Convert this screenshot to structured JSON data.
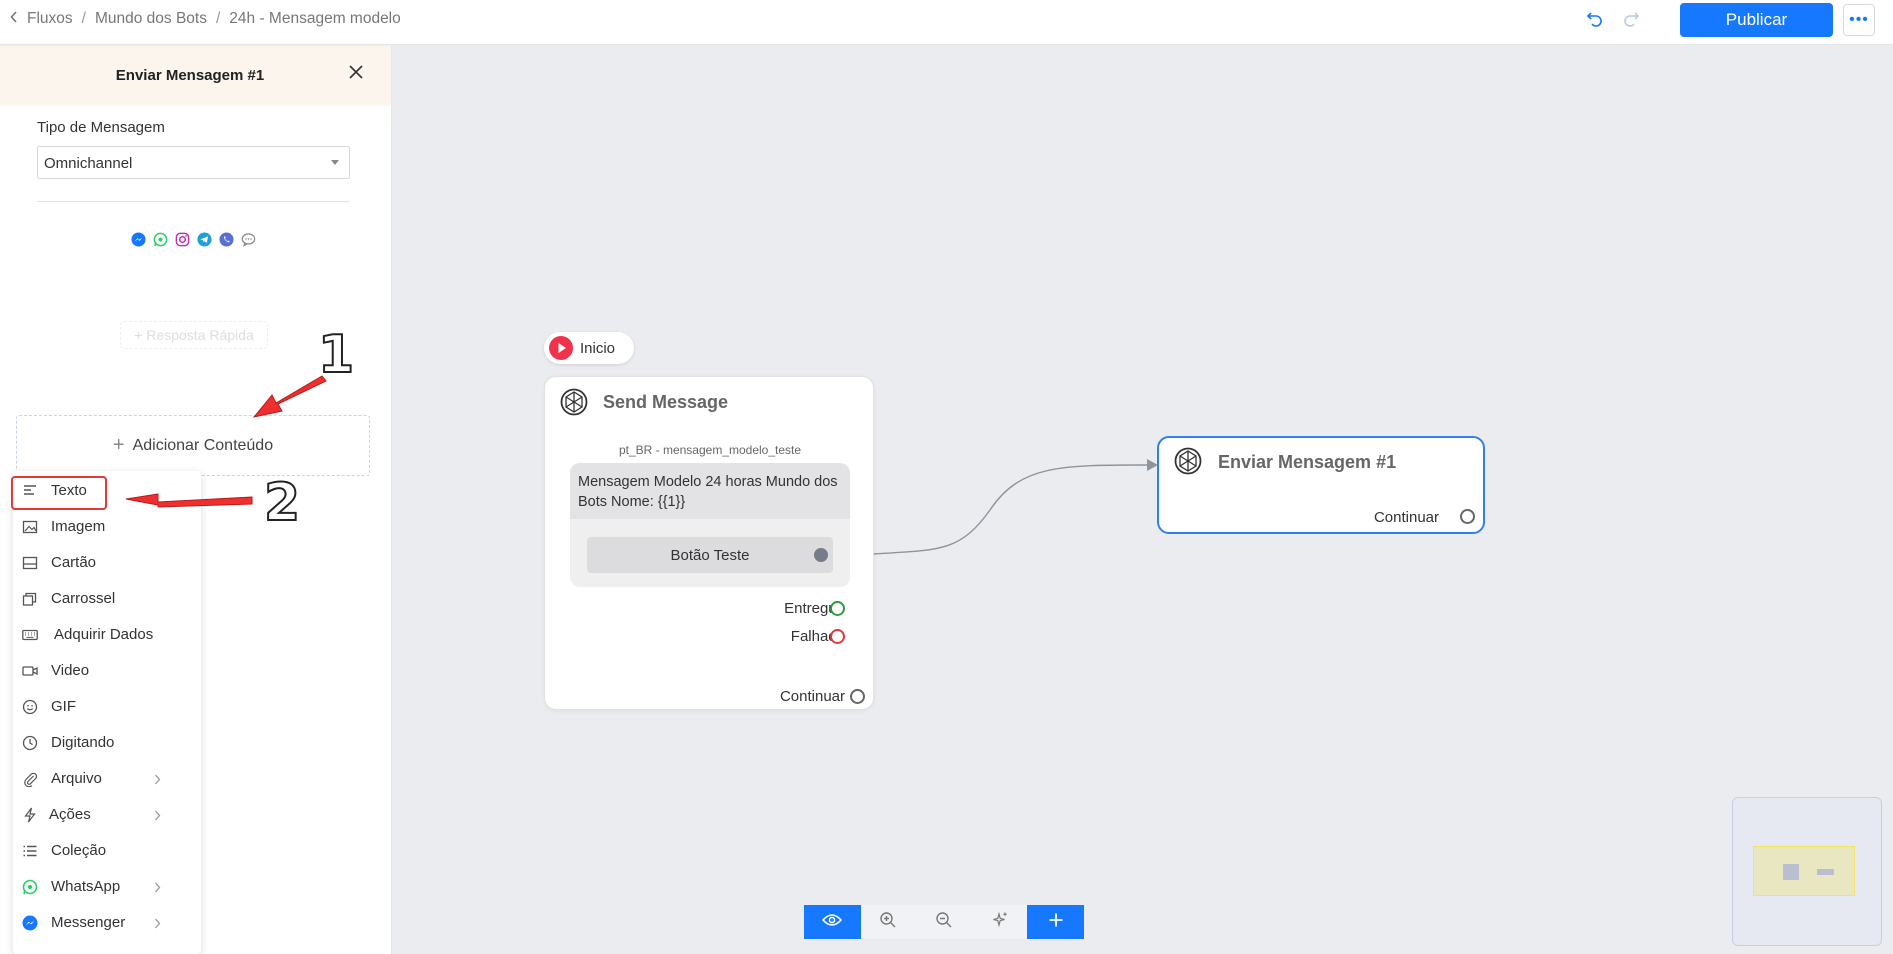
{
  "breadcrumb": {
    "items": [
      "Fluxos",
      "Mundo dos Bots",
      "24h - Mensagem modelo"
    ],
    "separator": "/"
  },
  "header": {
    "publish_label": "Publicar",
    "more_label": "•••"
  },
  "panel": {
    "title": "Enviar Mensagem #1",
    "message_type_label": "Tipo de Mensagem",
    "message_type_value": "Omnichannel",
    "channels": [
      "messenger-icon",
      "whatsapp-icon",
      "instagram-icon",
      "telegram-icon",
      "viber-icon",
      "chat-icon"
    ],
    "quick_reply_label": "+ Resposta Rápida",
    "add_content_label": "Adicionar Conteúdo"
  },
  "menu": {
    "items": [
      {
        "label": "Texto",
        "icon": "text-icon",
        "submenu": false
      },
      {
        "label": "Imagem",
        "icon": "image-icon",
        "submenu": false
      },
      {
        "label": "Cartão",
        "icon": "card-icon",
        "submenu": false
      },
      {
        "label": "Carrossel",
        "icon": "carousel-icon",
        "submenu": false
      },
      {
        "label": "Adquirir Dados",
        "icon": "keyboard-icon",
        "submenu": false
      },
      {
        "label": "Video",
        "icon": "video-icon",
        "submenu": false
      },
      {
        "label": "GIF",
        "icon": "gif-icon",
        "submenu": false
      },
      {
        "label": "Digitando",
        "icon": "clock-icon",
        "submenu": false
      },
      {
        "label": "Arquivo",
        "icon": "paperclip-icon",
        "submenu": true
      },
      {
        "label": "Ações",
        "icon": "lightning-icon",
        "submenu": true
      },
      {
        "label": "Coleção",
        "icon": "list-icon",
        "submenu": false
      },
      {
        "label": "WhatsApp",
        "icon": "whatsapp-icon",
        "submenu": true
      },
      {
        "label": "Messenger",
        "icon": "messenger-icon",
        "submenu": true
      }
    ]
  },
  "annotations": {
    "step1": "1",
    "step2": "2"
  },
  "canvas": {
    "start_label": "Inicio",
    "send_node": {
      "title": "Send Message",
      "template_name": "pt_BR - mensagem_modelo_teste",
      "message_text": "Mensagem Modelo 24 horas Mundo dos Bots Nome: {{1}}",
      "button_label": "Botão Teste",
      "delivered_label": "Entregue",
      "failed_label": "Falhado",
      "continue_label": "Continuar"
    },
    "target_node": {
      "title": "Enviar Mensagem #1",
      "continue_label": "Continuar"
    }
  },
  "colors": {
    "primary": "#1677ff",
    "start": "#f0334b",
    "delivered": "#2e9c3a",
    "failed": "#e53935",
    "selected_border": "#2f80ed"
  }
}
